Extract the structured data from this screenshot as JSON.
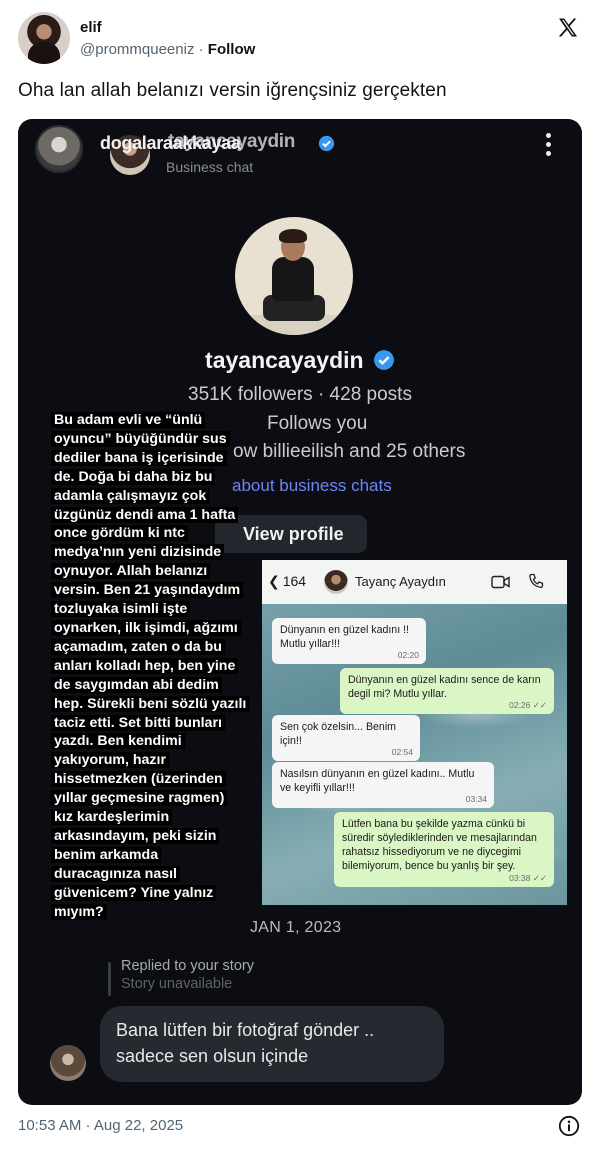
{
  "tweet": {
    "display_name": "elif",
    "handle": "@prommqueeniz",
    "separator": "·",
    "follow_label": "Follow",
    "text": "Oha lan allah belanızı versin iğrençsiniz gerçekten",
    "timestamp": "10:53 AM · Aug 22, 2025",
    "icons": {
      "logo": "x-logo-icon",
      "info": "info-icon"
    }
  },
  "media": {
    "chat_header": {
      "name": "dogalaraakkayaa",
      "ghost_name": "tayancayaydin",
      "subtitle": "Business chat",
      "menu_icon": "more-vertical-icon"
    },
    "profile": {
      "username": "tayancayaydin",
      "stats": "351K followers · 428 posts",
      "follows_you": "Follows you",
      "mutual": "ow billieeilish and 25 others",
      "about_link": "about business chats",
      "view_profile": "View profile",
      "verified_color": "#3897f0"
    },
    "story_text": "Bu adam evli ve “ünlü oyuncu” büyüğündür sus dediler bana iş içerisinde de. Doğa bi daha biz bu adamla çalışmayız çok üzgünüz dendi ama 1 hafta once gördüm ki ntc medya’nın yeni dizisinde oynuyor. Allah belanızı versin. Ben 21 yaşındaydım tozluyaka isimli işte oynarken, ilk işimdi, ağzımı açamadım, zaten o da bu anları kolladı hep, ben yine de saygımdan abi dedim hep. Sürekli beni sözlü yazılı taciz etti. Set bitti bunları yazdı. Ben kendimi yakıyorum, hazır hissetmezken (üzerinden yıllar geçmesine ragmen) kız kardeşlerimin arkasındayım, peki sizin benim arkamda duracagınıza nasıl güvenicem? Yine yalnız mıyım?",
    "whatsapp": {
      "back_count": "164",
      "contact_name": "Tayanç Ayaydın",
      "messages": [
        {
          "dir": "in",
          "text": "Dünyanın en güzel kadını !! Mutlu yıllar!!!",
          "time": "02:20"
        },
        {
          "dir": "out",
          "text": "Dünyanın en güzel kadını sence de karın degil mi? Mutlu yıllar.",
          "time": "02:26 ✓✓"
        },
        {
          "dir": "in",
          "text": "Sen çok özelsin... Benim için!!",
          "time": "02:54"
        },
        {
          "dir": "in",
          "text": "Nasılsın dünyanın en güzel kadını.. Mutlu ve keyifli yıllar!!!",
          "time": "03:34"
        },
        {
          "dir": "out",
          "text": "Lütfen bana bu şekilde yazma cünkü bi süredir söylediklerinden ve mesajlarından rahatsız hissediyorum ve ne diycegimi bilemiyorum, bence bu yanlış bir şey.",
          "time": "03:38 ✓✓"
        }
      ]
    },
    "date": "JAN 1, 2023",
    "replied": "Replied to your story",
    "unavailable": "Story unavailable",
    "dm_text": "Bana lütfen bir fotoğraf gönder .. sadece sen olsun içinde"
  }
}
